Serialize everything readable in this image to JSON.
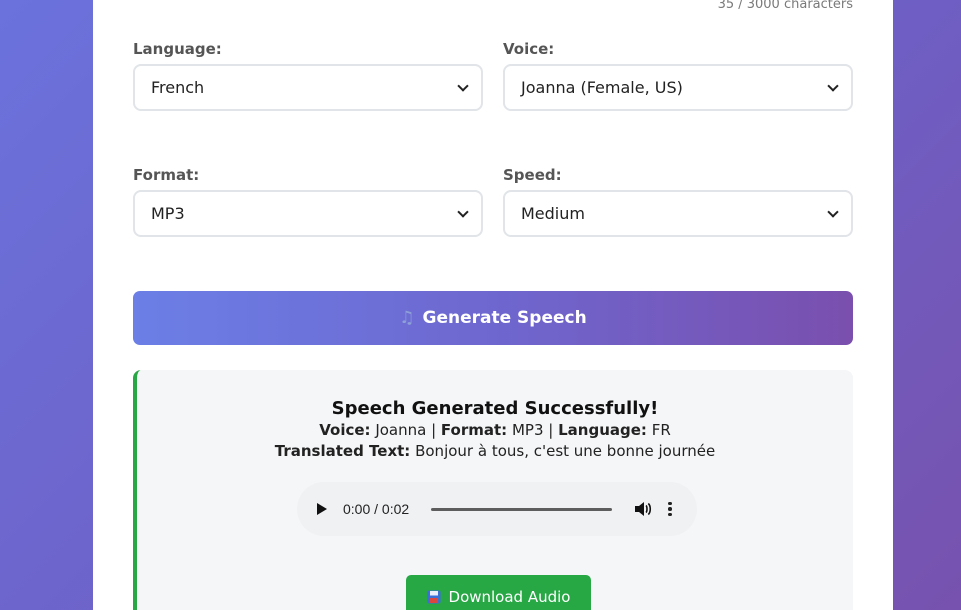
{
  "char_count": "35 / 3000 characters",
  "language": {
    "label": "Language:",
    "value": "French"
  },
  "voice": {
    "label": "Voice:",
    "value": "Joanna (Female, US)"
  },
  "format": {
    "label": "Format:",
    "value": "MP3"
  },
  "speed": {
    "label": "Speed:",
    "value": "Medium"
  },
  "generate_button": {
    "icon": "musical-note-icon",
    "label": "Generate Speech"
  },
  "result": {
    "title": "Speech Generated Successfully!",
    "voice_label": "Voice:",
    "voice_value": "Joanna",
    "format_label": "Format:",
    "format_value": "MP3",
    "language_label": "Language:",
    "language_value": "FR",
    "translated_label": "Translated Text:",
    "translated_value": "Bonjour à tous, c'est une bonne journée",
    "player_time": "0:00 / 0:02",
    "download_label": "Download Audio",
    "download_icon": "save-icon"
  },
  "colors": {
    "accent_gradient_start": "#6b7fe6",
    "accent_gradient_end": "#7a4fae",
    "success": "#28a745"
  }
}
